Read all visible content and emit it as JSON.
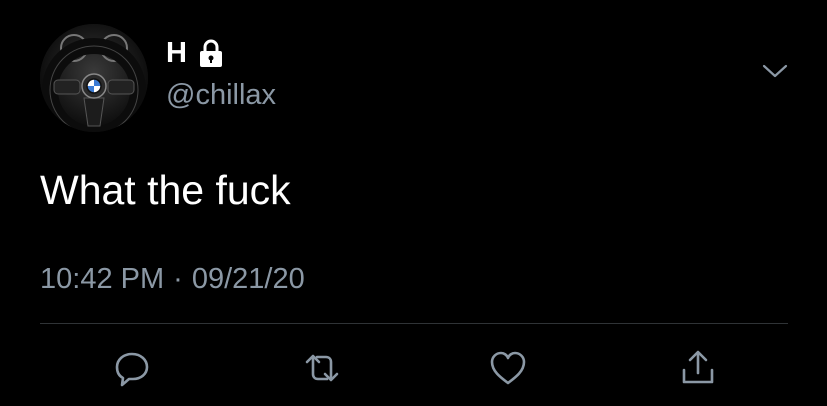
{
  "tweet": {
    "author": {
      "display_name": "H",
      "handle": "@chillax",
      "protected_icon": "lock-icon",
      "avatar_icon": "steering-wheel-avatar"
    },
    "text": "What the fuck",
    "time": "10:42 PM",
    "separator": "·",
    "date": "09/21/20"
  },
  "menu_icon": "chevron-down-icon",
  "actions": [
    {
      "name": "reply",
      "icon": "reply-icon"
    },
    {
      "name": "retweet",
      "icon": "retweet-icon"
    },
    {
      "name": "like",
      "icon": "heart-icon"
    },
    {
      "name": "share",
      "icon": "share-icon"
    }
  ],
  "colors": {
    "background": "#000000",
    "primary_text": "#ffffff",
    "secondary_text": "#8b98a5",
    "divider": "#2f3336"
  }
}
